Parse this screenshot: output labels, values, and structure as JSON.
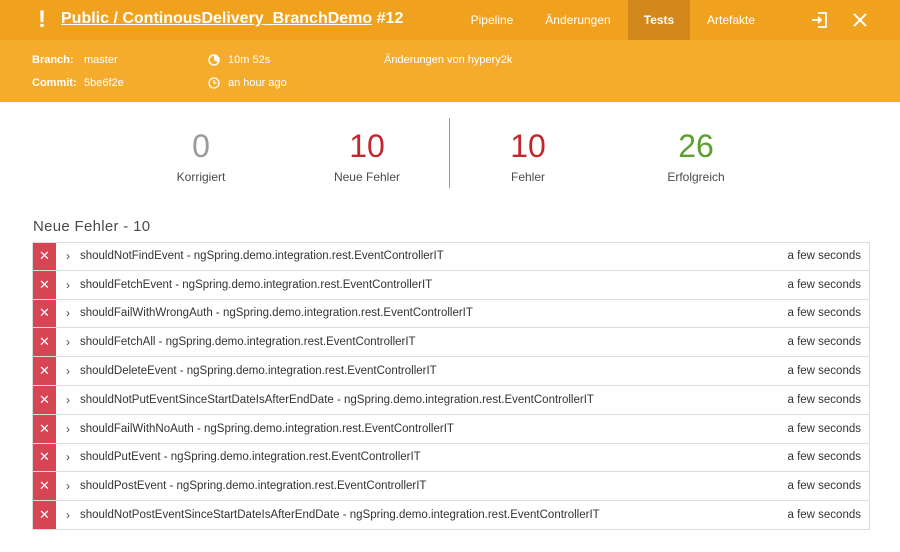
{
  "header": {
    "status_glyph": "!",
    "project": "Public / ContinousDelivery_BranchDemo",
    "run": "#12",
    "tabs": [
      "Pipeline",
      "Änderungen",
      "Tests",
      "Artefakte"
    ],
    "active_tab": "Tests",
    "accent_color": "#f0a21f"
  },
  "info": {
    "branch_label": "Branch:",
    "branch_value": "master",
    "commit_label": "Commit:",
    "commit_value": "5be6f2e",
    "duration": "10m 52s",
    "time": "an hour ago",
    "changes_by": "Änderungen von hypery2k"
  },
  "stats": {
    "fixed": {
      "value": "0",
      "label": "Korrigiert"
    },
    "new_failures": {
      "value": "10",
      "label": "Neue Fehler"
    },
    "failed": {
      "value": "10",
      "label": "Fehler"
    },
    "passed": {
      "value": "26",
      "label": "Erfolgreich"
    }
  },
  "section": {
    "title": "Neue Fehler - 10"
  },
  "tests": [
    {
      "name": "shouldNotFindEvent - ngSpring.demo.integration.rest.EventControllerIT",
      "duration": "a few seconds"
    },
    {
      "name": "shouldFetchEvent - ngSpring.demo.integration.rest.EventControllerIT",
      "duration": "a few seconds"
    },
    {
      "name": "shouldFailWithWrongAuth - ngSpring.demo.integration.rest.EventControllerIT",
      "duration": "a few seconds"
    },
    {
      "name": "shouldFetchAll - ngSpring.demo.integration.rest.EventControllerIT",
      "duration": "a few seconds"
    },
    {
      "name": "shouldDeleteEvent - ngSpring.demo.integration.rest.EventControllerIT",
      "duration": "a few seconds"
    },
    {
      "name": "shouldNotPutEventSinceStartDateIsAfterEndDate - ngSpring.demo.integration.rest.EventControllerIT",
      "duration": "a few seconds"
    },
    {
      "name": "shouldFailWithNoAuth - ngSpring.demo.integration.rest.EventControllerIT",
      "duration": "a few seconds"
    },
    {
      "name": "shouldPutEvent - ngSpring.demo.integration.rest.EventControllerIT",
      "duration": "a few seconds"
    },
    {
      "name": "shouldPostEvent - ngSpring.demo.integration.rest.EventControllerIT",
      "duration": "a few seconds"
    },
    {
      "name": "shouldNotPostEventSinceStartDateIsAfterEndDate - ngSpring.demo.integration.rest.EventControllerIT",
      "duration": "a few seconds"
    }
  ],
  "icons": {
    "status": "exclamation-icon",
    "exit": "exit-icon",
    "close": "close-icon",
    "duration": "timer-icon",
    "time": "clock-icon",
    "row_status": "failure-x-icon",
    "row_expand": "chevron-right-icon"
  }
}
